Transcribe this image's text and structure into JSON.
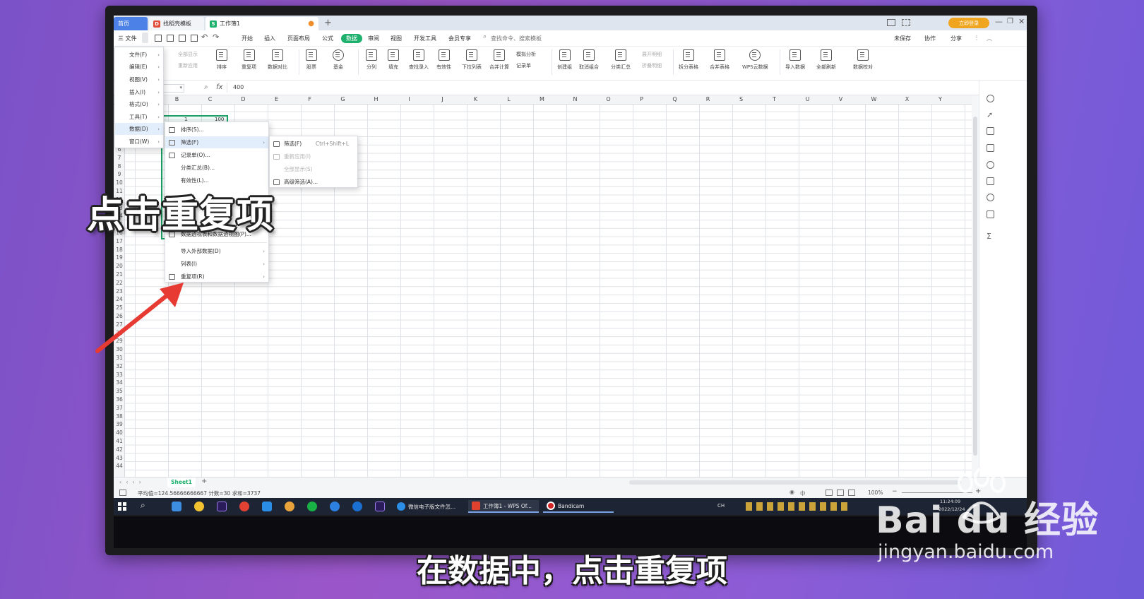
{
  "tabs": [
    {
      "label": "首页"
    },
    {
      "label": "找稻壳模板"
    },
    {
      "label": "工作簿1"
    }
  ],
  "title_bar": {
    "login_label": "立即登录"
  },
  "menu": {
    "file_label": "三 文件",
    "items": [
      "开始",
      "插入",
      "页面布局",
      "公式",
      "数据",
      "审阅",
      "视图",
      "开发工具",
      "会员专享"
    ],
    "search_placeholder": "查找命令、搜索模板",
    "right": [
      "未保存",
      "协作",
      "分享"
    ]
  },
  "ribbon": {
    "small_left": [
      "全部显示",
      "重新应用"
    ],
    "buttons": [
      "排序",
      "重复项",
      "数据对比",
      "股票",
      "基金",
      "分列",
      "填充",
      "查找录入",
      "有效性",
      "下拉列表",
      "合并计算",
      "创建组",
      "取消组合",
      "分类汇总",
      "拆分表格",
      "合并表格",
      "WPS云数据",
      "导入数据",
      "全部刷新",
      "数据校对"
    ],
    "small_right": [
      "模拟分析",
      "记录单",
      "展开明细",
      "折叠明细"
    ]
  },
  "formula": {
    "name_box": "",
    "fx": "fx",
    "value": "400"
  },
  "columns": [
    "B",
    "C",
    "D",
    "E",
    "F",
    "G",
    "H",
    "I",
    "J",
    "K",
    "L",
    "M",
    "N",
    "O",
    "P",
    "Q",
    "R",
    "S",
    "T",
    "U",
    "V",
    "W",
    "X",
    "Y"
  ],
  "rows": [
    "6",
    "7",
    "8",
    "9",
    "10",
    "11",
    "12",
    "13",
    "14",
    "15",
    "16",
    "17",
    "18",
    "19",
    "20",
    "21",
    "22",
    "23",
    "24",
    "25",
    "26",
    "27",
    "28",
    "29",
    "30",
    "31",
    "32",
    "33",
    "34",
    "35",
    "36",
    "37",
    "38",
    "39",
    "40",
    "41",
    "42",
    "43",
    "44"
  ],
  "cell_values": [
    "1",
    "100"
  ],
  "file_menu": [
    "文件(F)",
    "编辑(E)",
    "视图(V)",
    "插入(I)",
    "格式(O)",
    "工具(T)",
    "数据(D)",
    "窗口(W)"
  ],
  "data_menu": [
    "排序(S)...",
    "筛选(F)",
    "记录单(O)...",
    "分类汇总(B)...",
    "有效性(L)...",
    "数据透视表和数据透视图(P)...",
    "导入外部数据(D)",
    "列表(I)",
    "重复项(R)"
  ],
  "filter_menu": [
    {
      "label": "筛选(F)",
      "shortcut": "Ctrl+Shift+L"
    },
    {
      "label": "重新应用(I)",
      "shortcut": ""
    },
    {
      "label": "全部显示(S)",
      "shortcut": ""
    },
    {
      "label": "高级筛选(A)...",
      "shortcut": ""
    }
  ],
  "sheet": {
    "tab": "Sheet1"
  },
  "status": {
    "text": "平均值=124.56666666667  计数=30  求和=3737",
    "zoom": "100%"
  },
  "taskbar": {
    "apps": [
      "微信电子版文件怎...",
      "工作簿1 - WPS Of...",
      "Bandicam"
    ],
    "time": "11:24:09",
    "date": "2022/12/24",
    "ime": "CH",
    "lang": "中"
  },
  "overlay": {
    "caption": "点击重复项",
    "subtitle": "在数据中，点击重复项"
  },
  "watermark": {
    "logo": "Bai du 经验",
    "url": "jingyan.baidu.com"
  },
  "colors": {
    "wps_green": "#1eb06d",
    "tab_blue": "#4c82e8",
    "login_orange": "#f0a51e"
  }
}
